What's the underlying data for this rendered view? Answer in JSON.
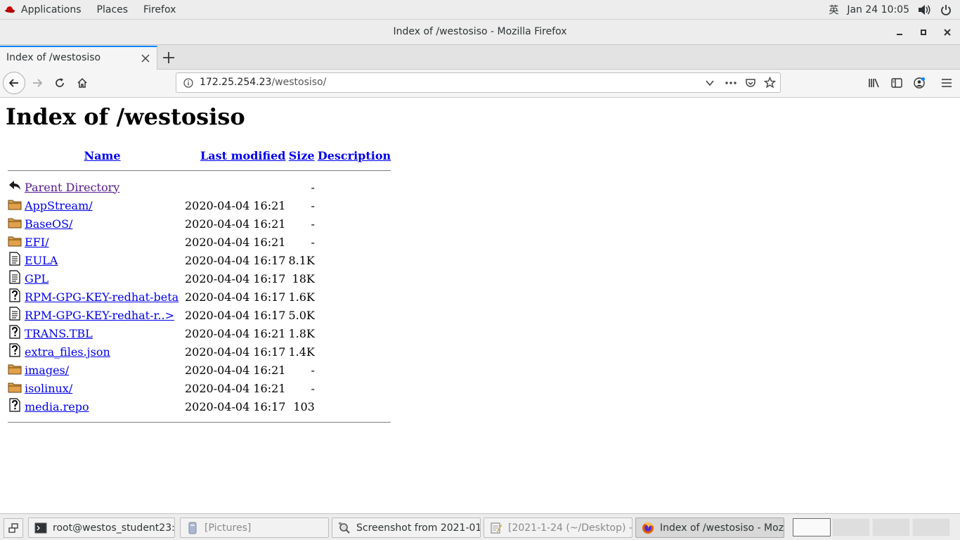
{
  "topbar": {
    "applications": "Applications",
    "places": "Places",
    "firefox": "Firefox",
    "input_method": "英",
    "clock": "Jan 24  10:05"
  },
  "window": {
    "title": "Index of /westosiso - Mozilla Firefox"
  },
  "tab": {
    "label": "Index of /westosiso"
  },
  "urlbar": {
    "host": "172.25.254.23",
    "path": "/westosiso/"
  },
  "page": {
    "heading": "Index of /westosiso",
    "columns": {
      "name": "Name",
      "last_modified": "Last modified",
      "size": "Size",
      "description": "Description"
    },
    "rows": [
      {
        "icon": "parent-directory-icon",
        "name": "Parent Directory",
        "modified": "",
        "size": "-"
      },
      {
        "icon": "folder-icon",
        "name": "AppStream/",
        "modified": "2020-04-04 16:21",
        "size": "-"
      },
      {
        "icon": "folder-icon",
        "name": "BaseOS/",
        "modified": "2020-04-04 16:21",
        "size": "-"
      },
      {
        "icon": "folder-icon",
        "name": "EFI/",
        "modified": "2020-04-04 16:21",
        "size": "-"
      },
      {
        "icon": "text-file-icon",
        "name": "EULA",
        "modified": "2020-04-04 16:17",
        "size": "8.1K"
      },
      {
        "icon": "text-file-icon",
        "name": "GPL",
        "modified": "2020-04-04 16:17",
        "size": "18K"
      },
      {
        "icon": "unknown-file-icon",
        "name": "RPM-GPG-KEY-redhat-beta",
        "modified": "2020-04-04 16:17",
        "size": "1.6K"
      },
      {
        "icon": "text-file-icon",
        "name": "RPM-GPG-KEY-redhat-r..>",
        "modified": "2020-04-04 16:17",
        "size": "5.0K"
      },
      {
        "icon": "unknown-file-icon",
        "name": "TRANS.TBL",
        "modified": "2020-04-04 16:21",
        "size": "1.8K"
      },
      {
        "icon": "unknown-file-icon",
        "name": "extra_files.json",
        "modified": "2020-04-04 16:17",
        "size": "1.4K"
      },
      {
        "icon": "folder-icon",
        "name": "images/",
        "modified": "2020-04-04 16:21",
        "size": "-"
      },
      {
        "icon": "folder-icon",
        "name": "isolinux/",
        "modified": "2020-04-04 16:21",
        "size": "-"
      },
      {
        "icon": "unknown-file-icon",
        "name": "media.repo",
        "modified": "2020-04-04 16:17",
        "size": "103"
      }
    ]
  },
  "taskbar": {
    "items": [
      {
        "label": "root@westos_student23:~",
        "icon": "terminal-icon"
      },
      {
        "label": "[Pictures]",
        "icon": "file-manager-icon"
      },
      {
        "label": "Screenshot from 2021-01...",
        "icon": "screenshot-icon"
      },
      {
        "label": "[2021-1-24 (~/Desktop) - ...",
        "icon": "text-editor-icon"
      },
      {
        "label": "Index of /westosiso - Mozil...",
        "icon": "firefox-icon"
      }
    ]
  },
  "colors": {
    "link": "#0000ee",
    "visited_link": "#551a8b",
    "accent": "#0a84ff"
  }
}
